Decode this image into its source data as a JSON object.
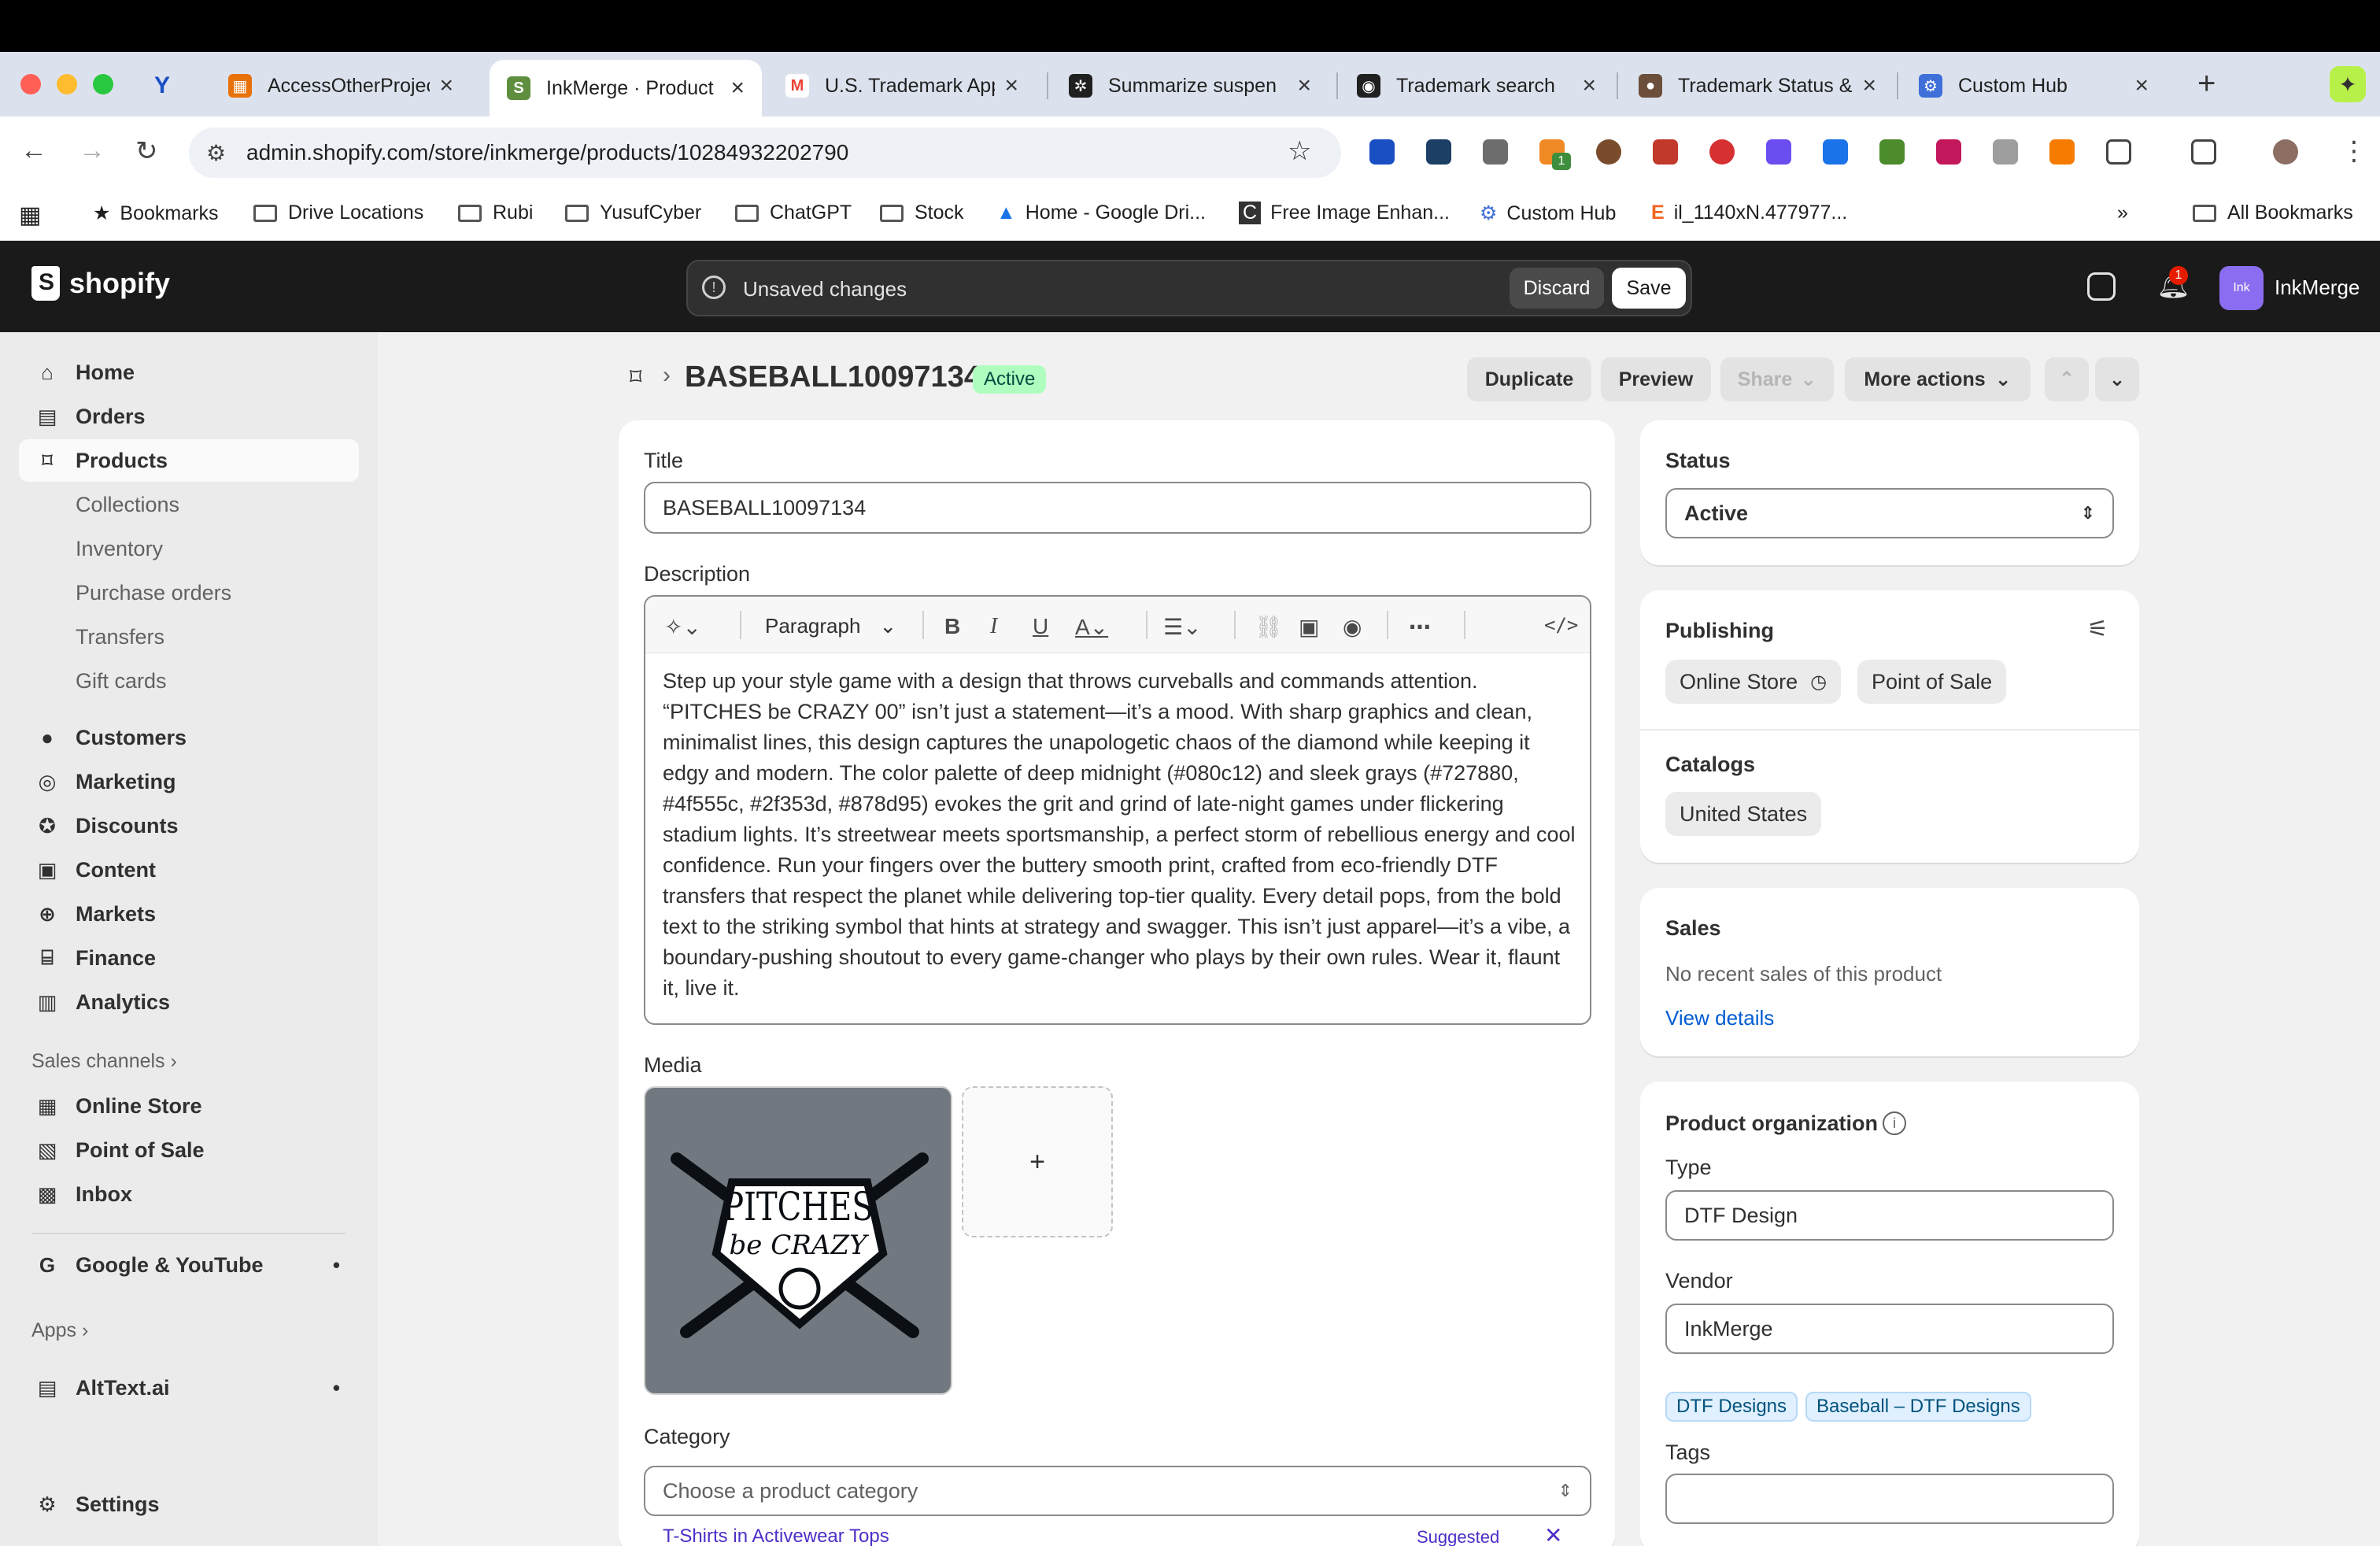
{
  "browser": {
    "tabs": [
      {
        "label": "AccessOtherProjec",
        "icon_color": "#e8710a"
      },
      {
        "label": "InkMerge · Product",
        "icon_color": "#5e8e3e"
      },
      {
        "label": "U.S. Trademark App",
        "icon_color": "#ea4335"
      },
      {
        "label": "Summarize suspen",
        "icon_color": "#202020"
      },
      {
        "label": "Trademark search",
        "icon_color": "#202020"
      },
      {
        "label": "Trademark Status &",
        "icon_color": "#6b4f3a"
      },
      {
        "label": "Custom Hub",
        "icon_color": "#3f6fd8"
      }
    ],
    "url": "admin.shopify.com/store/inkmerge/products/10284932202790",
    "bookmarks": [
      "Bookmarks",
      "Drive Locations",
      "Rubi",
      "YusufCyber",
      "ChatGPT",
      "Stock",
      "Home - Google Dri...",
      "Free Image Enhan...",
      "Custom Hub",
      "il_1140xN.477977...",
      "All Bookmarks"
    ],
    "ext_badge": "1"
  },
  "shopify": {
    "logo_text": "shopify",
    "unsaved_text": "Unsaved changes",
    "discard_label": "Discard",
    "save_label": "Save",
    "notif_count": "1",
    "avatar_text": "Ink",
    "store_name": "InkMerge"
  },
  "sidebar": {
    "items": [
      {
        "label": "Home",
        "icon": "home-icon"
      },
      {
        "label": "Orders",
        "icon": "orders-icon"
      },
      {
        "label": "Products",
        "icon": "tag-icon"
      },
      {
        "label": "Collections"
      },
      {
        "label": "Inventory"
      },
      {
        "label": "Purchase orders"
      },
      {
        "label": "Transfers"
      },
      {
        "label": "Gift cards"
      },
      {
        "label": "Customers",
        "icon": "person-icon"
      },
      {
        "label": "Marketing",
        "icon": "target-icon"
      },
      {
        "label": "Discounts",
        "icon": "discount-icon"
      },
      {
        "label": "Content",
        "icon": "content-icon"
      },
      {
        "label": "Markets",
        "icon": "globe-icon"
      },
      {
        "label": "Finance",
        "icon": "bank-icon"
      },
      {
        "label": "Analytics",
        "icon": "chart-icon"
      }
    ],
    "sales_channels_label": "Sales channels",
    "channels": [
      "Online Store",
      "Point of Sale",
      "Inbox"
    ],
    "google": "Google & YouTube",
    "apps_label": "Apps",
    "app": "AltText.ai",
    "settings": "Settings"
  },
  "product": {
    "heading": "BASEBALL10097134",
    "status_badge": "Active",
    "actions": {
      "duplicate": "Duplicate",
      "preview": "Preview",
      "share": "Share",
      "more": "More actions"
    },
    "title_label": "Title",
    "title_value": "BASEBALL10097134",
    "description_label": "Description",
    "paragraph_select": "Paragraph",
    "description": "Step up your style game with a design that throws curveballs and commands attention. “PITCHES be CRAZY 00” isn’t just a statement—it’s a mood. With sharp graphics and clean, minimalist lines, this design captures the unapologetic chaos of the diamond while keeping it edgy and modern. The color palette of deep midnight (#080c12) and sleek grays (#727880, #4f555c, #2f353d, #878d95) evokes the grit and grind of late-night games under flickering stadium lights. It’s streetwear meets sportsmanship, a perfect storm of rebellious energy and cool confidence. Run your fingers over the buttery smooth print, crafted from eco-friendly DTF transfers that respect the planet while delivering top-tier quality. Every detail pops, from the bold text to the striking symbol that hints at strategy and swagger. This isn’t just apparel—it’s a vibe, a boundary-pushing shoutout to every game-changer who plays by their own rules. Wear it, flaunt it, live it.",
    "media_label": "Media",
    "media_image_text_1": "PITCHES",
    "media_image_text_2": "be CRAZY",
    "add_media": "+",
    "category_label": "Category",
    "category_placeholder": "Choose a product category",
    "suggestion_name": "T-Shirts",
    "suggestion_in": "in Activewear Tops",
    "suggested_label": "Suggested"
  },
  "right": {
    "status_label": "Status",
    "status_value": "Active",
    "publishing_label": "Publishing",
    "channels": [
      "Online Store",
      "Point of Sale"
    ],
    "catalogs_label": "Catalogs",
    "catalog": "United States",
    "sales_label": "Sales",
    "sales_text": "No recent sales of this product",
    "view_details": "View details",
    "org_label": "Product organization",
    "type_label": "Type",
    "type_value": "DTF Design",
    "vendor_label": "Vendor",
    "vendor_value": "InkMerge",
    "collections": [
      "DTF Designs",
      "Baseball – DTF Designs"
    ],
    "tags_label": "Tags"
  }
}
